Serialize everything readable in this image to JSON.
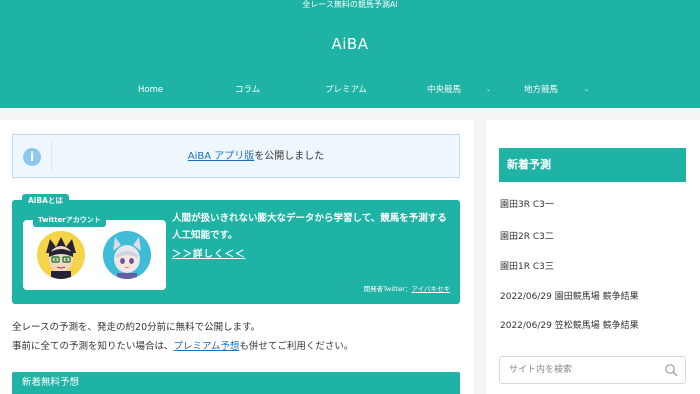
{
  "header": {
    "tagline": "全レース無料の競馬予測AI",
    "site_title": "AiBA",
    "nav": [
      {
        "label": "Home"
      },
      {
        "label": "コラム"
      },
      {
        "label": "プレミアム"
      },
      {
        "label": "中央競馬",
        "has_dropdown": true
      },
      {
        "label": "地方競馬",
        "has_dropdown": true
      }
    ],
    "caret": "⌄"
  },
  "notice": {
    "icon": "info-icon",
    "icon_glyph": "i",
    "link_text": "AiBA アプリ版",
    "suffix_text": "を公開しました"
  },
  "about": {
    "label": "AiBAとは",
    "twitter_label": "Twitterアカウント",
    "description": "人間が扱いきれない膨大なデータから学習して、競馬を予測する人工知能です。",
    "more_link": "＞＞詳しく＜＜",
    "dev_prefix": "開発者Twitter：",
    "dev_link": "アイバキセキ"
  },
  "intro": {
    "line1": "全レースの予測を、発走の約20分前に無料で公開します。",
    "line2_prefix": "事前に全ての予測を知りたい場合は、",
    "line2_link": "プレミアム予想",
    "line2_suffix": "も併せてご利用ください。"
  },
  "section": {
    "title": "新着無料予想"
  },
  "sidebar": {
    "title": "新着予測",
    "items": [
      "園田3R C3一",
      "園田2R C3二",
      "園田1R C3三",
      "2022/06/29 園田競馬場 競争結果",
      "2022/06/29 笠松競馬場 競争結果"
    ],
    "search_placeholder": "サイト内を検索",
    "search_icon": "search-icon"
  },
  "colors": {
    "brand": "#1fb3a5",
    "link": "#1a6fc4",
    "notice_bg": "#eef7fd",
    "info_icon": "#8dc8ec"
  }
}
